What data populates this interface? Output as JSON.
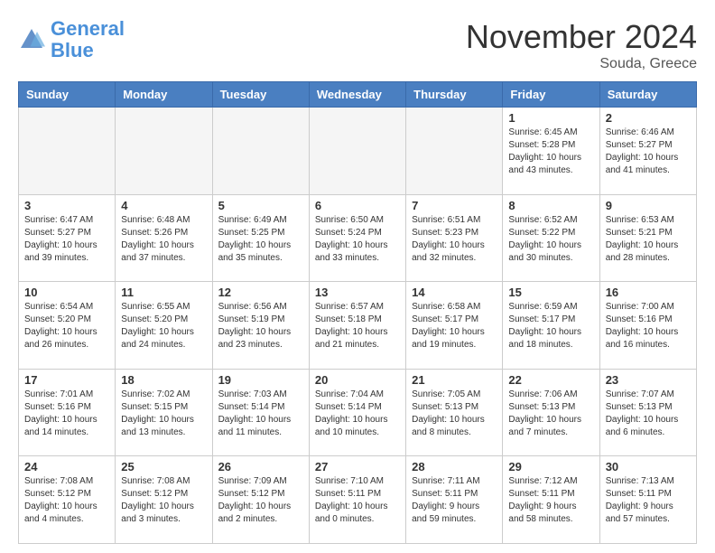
{
  "logo": {
    "line1": "General",
    "line2": "Blue"
  },
  "title": "November 2024",
  "location": "Souda, Greece",
  "days_of_week": [
    "Sunday",
    "Monday",
    "Tuesday",
    "Wednesday",
    "Thursday",
    "Friday",
    "Saturday"
  ],
  "weeks": [
    [
      {
        "day": "",
        "info": ""
      },
      {
        "day": "",
        "info": ""
      },
      {
        "day": "",
        "info": ""
      },
      {
        "day": "",
        "info": ""
      },
      {
        "day": "",
        "info": ""
      },
      {
        "day": "1",
        "info": "Sunrise: 6:45 AM\nSunset: 5:28 PM\nDaylight: 10 hours\nand 43 minutes."
      },
      {
        "day": "2",
        "info": "Sunrise: 6:46 AM\nSunset: 5:27 PM\nDaylight: 10 hours\nand 41 minutes."
      }
    ],
    [
      {
        "day": "3",
        "info": "Sunrise: 6:47 AM\nSunset: 5:27 PM\nDaylight: 10 hours\nand 39 minutes."
      },
      {
        "day": "4",
        "info": "Sunrise: 6:48 AM\nSunset: 5:26 PM\nDaylight: 10 hours\nand 37 minutes."
      },
      {
        "day": "5",
        "info": "Sunrise: 6:49 AM\nSunset: 5:25 PM\nDaylight: 10 hours\nand 35 minutes."
      },
      {
        "day": "6",
        "info": "Sunrise: 6:50 AM\nSunset: 5:24 PM\nDaylight: 10 hours\nand 33 minutes."
      },
      {
        "day": "7",
        "info": "Sunrise: 6:51 AM\nSunset: 5:23 PM\nDaylight: 10 hours\nand 32 minutes."
      },
      {
        "day": "8",
        "info": "Sunrise: 6:52 AM\nSunset: 5:22 PM\nDaylight: 10 hours\nand 30 minutes."
      },
      {
        "day": "9",
        "info": "Sunrise: 6:53 AM\nSunset: 5:21 PM\nDaylight: 10 hours\nand 28 minutes."
      }
    ],
    [
      {
        "day": "10",
        "info": "Sunrise: 6:54 AM\nSunset: 5:20 PM\nDaylight: 10 hours\nand 26 minutes."
      },
      {
        "day": "11",
        "info": "Sunrise: 6:55 AM\nSunset: 5:20 PM\nDaylight: 10 hours\nand 24 minutes."
      },
      {
        "day": "12",
        "info": "Sunrise: 6:56 AM\nSunset: 5:19 PM\nDaylight: 10 hours\nand 23 minutes."
      },
      {
        "day": "13",
        "info": "Sunrise: 6:57 AM\nSunset: 5:18 PM\nDaylight: 10 hours\nand 21 minutes."
      },
      {
        "day": "14",
        "info": "Sunrise: 6:58 AM\nSunset: 5:17 PM\nDaylight: 10 hours\nand 19 minutes."
      },
      {
        "day": "15",
        "info": "Sunrise: 6:59 AM\nSunset: 5:17 PM\nDaylight: 10 hours\nand 18 minutes."
      },
      {
        "day": "16",
        "info": "Sunrise: 7:00 AM\nSunset: 5:16 PM\nDaylight: 10 hours\nand 16 minutes."
      }
    ],
    [
      {
        "day": "17",
        "info": "Sunrise: 7:01 AM\nSunset: 5:16 PM\nDaylight: 10 hours\nand 14 minutes."
      },
      {
        "day": "18",
        "info": "Sunrise: 7:02 AM\nSunset: 5:15 PM\nDaylight: 10 hours\nand 13 minutes."
      },
      {
        "day": "19",
        "info": "Sunrise: 7:03 AM\nSunset: 5:14 PM\nDaylight: 10 hours\nand 11 minutes."
      },
      {
        "day": "20",
        "info": "Sunrise: 7:04 AM\nSunset: 5:14 PM\nDaylight: 10 hours\nand 10 minutes."
      },
      {
        "day": "21",
        "info": "Sunrise: 7:05 AM\nSunset: 5:13 PM\nDaylight: 10 hours\nand 8 minutes."
      },
      {
        "day": "22",
        "info": "Sunrise: 7:06 AM\nSunset: 5:13 PM\nDaylight: 10 hours\nand 7 minutes."
      },
      {
        "day": "23",
        "info": "Sunrise: 7:07 AM\nSunset: 5:13 PM\nDaylight: 10 hours\nand 6 minutes."
      }
    ],
    [
      {
        "day": "24",
        "info": "Sunrise: 7:08 AM\nSunset: 5:12 PM\nDaylight: 10 hours\nand 4 minutes."
      },
      {
        "day": "25",
        "info": "Sunrise: 7:08 AM\nSunset: 5:12 PM\nDaylight: 10 hours\nand 3 minutes."
      },
      {
        "day": "26",
        "info": "Sunrise: 7:09 AM\nSunset: 5:12 PM\nDaylight: 10 hours\nand 2 minutes."
      },
      {
        "day": "27",
        "info": "Sunrise: 7:10 AM\nSunset: 5:11 PM\nDaylight: 10 hours\nand 0 minutes."
      },
      {
        "day": "28",
        "info": "Sunrise: 7:11 AM\nSunset: 5:11 PM\nDaylight: 9 hours\nand 59 minutes."
      },
      {
        "day": "29",
        "info": "Sunrise: 7:12 AM\nSunset: 5:11 PM\nDaylight: 9 hours\nand 58 minutes."
      },
      {
        "day": "30",
        "info": "Sunrise: 7:13 AM\nSunset: 5:11 PM\nDaylight: 9 hours\nand 57 minutes."
      }
    ]
  ]
}
